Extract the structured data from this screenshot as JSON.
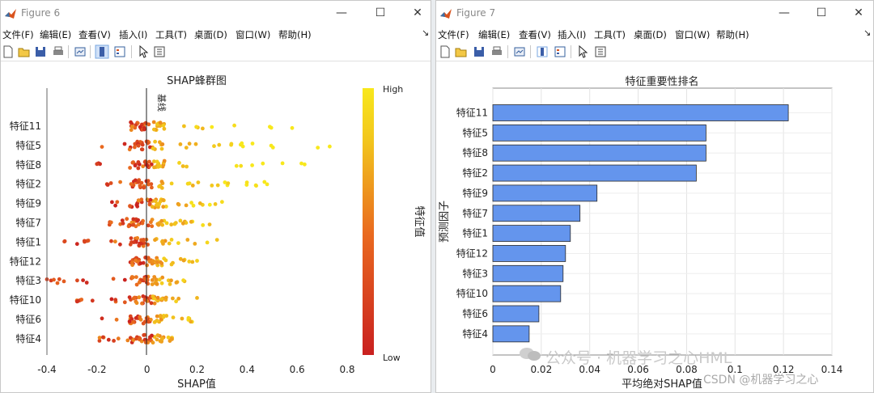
{
  "windows": [
    {
      "title": "Figure 6",
      "menu": [
        "文件(F)",
        "编辑(E)",
        "查看(V)",
        "插入(I)",
        "工具(T)",
        "桌面(D)",
        "窗口(W)",
        "帮助(H)"
      ],
      "menu_arrow": "↘"
    },
    {
      "title": "Figure 7",
      "menu": [
        "文件(F)",
        "编辑(E)",
        "查看(V)",
        "插入(I)",
        "工具(T)",
        "桌面(D)",
        "窗口(W)",
        "帮助(H)"
      ],
      "menu_arrow": "↘"
    }
  ],
  "window_controls": {
    "minimize": "—",
    "maximize": "☐",
    "close": "✕"
  },
  "chart_data": [
    {
      "type": "scatter",
      "title": "SHAP蜂群图",
      "xlabel": "SHAP值",
      "ylabel": "",
      "xlim": [
        -0.4,
        0.8
      ],
      "xticks": [
        "-0.4",
        "-0.2",
        "0",
        "0.2",
        "0.4",
        "0.6",
        "0.8"
      ],
      "zero_line_label": "基线",
      "features": [
        "特征11",
        "特征5",
        "特征8",
        "特征2",
        "特征9",
        "特征7",
        "特征1",
        "特征12",
        "特征3",
        "特征10",
        "特征6",
        "特征4"
      ],
      "feature_ranges": [
        [
          -0.06,
          0.58
        ],
        [
          -0.18,
          0.73
        ],
        [
          -0.2,
          0.63
        ],
        [
          -0.16,
          0.48
        ],
        [
          -0.14,
          0.3
        ],
        [
          -0.15,
          0.25
        ],
        [
          -0.33,
          0.28
        ],
        [
          -0.04,
          0.2
        ],
        [
          -0.4,
          0.15
        ],
        [
          -0.28,
          0.2
        ],
        [
          -0.18,
          0.18
        ],
        [
          -0.19,
          0.1
        ]
      ],
      "colorbar": {
        "label": "特征值",
        "high": "High",
        "low": "Low",
        "colors": [
          "#c9201f",
          "#e9691f",
          "#f2c51d",
          "#f8e81c"
        ]
      },
      "grid": false
    },
    {
      "type": "bar",
      "orientation": "horizontal",
      "title": "特征重要性排名",
      "xlabel": "平均绝对SHAP值",
      "ylabel": "预测因子",
      "categories": [
        "特征11",
        "特征5",
        "特征8",
        "特征2",
        "特征9",
        "特征7",
        "特征1",
        "特征12",
        "特征3",
        "特征10",
        "特征6",
        "特征4"
      ],
      "values": [
        0.122,
        0.088,
        0.088,
        0.084,
        0.043,
        0.036,
        0.032,
        0.03,
        0.029,
        0.028,
        0.019,
        0.015
      ],
      "xlim": [
        0,
        0.14
      ],
      "xticks": [
        "0",
        "0.02",
        "0.04",
        "0.06",
        "0.08",
        "0.1",
        "0.12",
        "0.14"
      ],
      "bar_color": "#6495ed",
      "grid": true
    }
  ],
  "watermarks": [
    "公众号 · 机器学习之心HML",
    "CSDN @机器学习之心"
  ]
}
